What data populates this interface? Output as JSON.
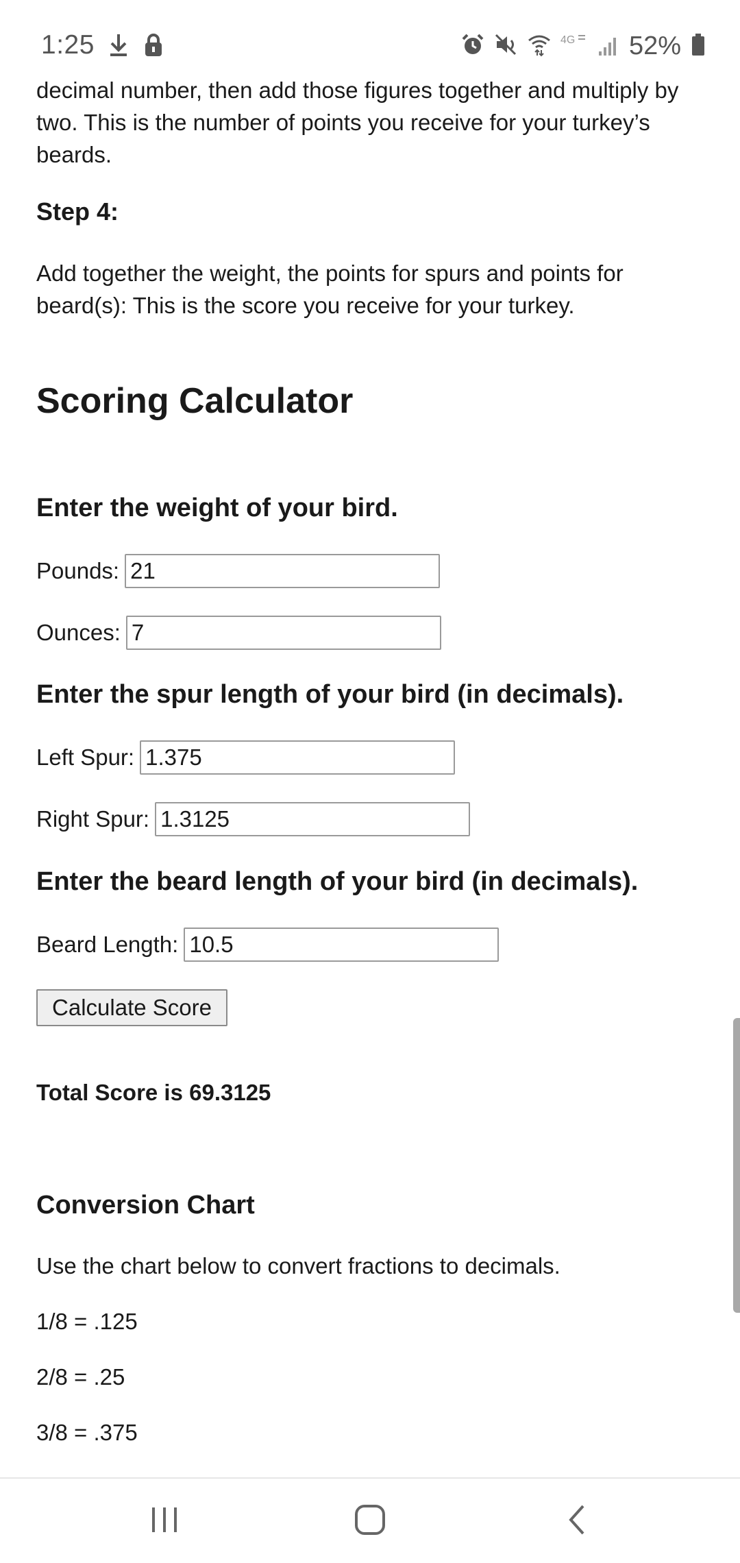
{
  "status_bar": {
    "time": "1:25",
    "battery_percent": "52%",
    "left_icons": [
      "download-icon",
      "lock-icon"
    ],
    "right_icons": [
      "alarm-icon",
      "mute-icon",
      "wifi-icon",
      "4g-icon",
      "signal-icon",
      "battery-icon"
    ],
    "network_label": "4G"
  },
  "intro": {
    "paragraph": "decimal number, then add those figures together and multiply by two. This is the number of points you receive for your turkey’s beards."
  },
  "step4": {
    "heading": "Step 4:",
    "text": "Add together the weight, the points for spurs and points for beard(s): This is the score you receive for your turkey."
  },
  "calculator": {
    "title": "Scoring Calculator",
    "weight_heading": "Enter the weight of your bird.",
    "pounds_label": "Pounds:",
    "pounds_value": "21",
    "ounces_label": "Ounces:",
    "ounces_value": "7",
    "spur_heading": "Enter the spur length of your bird (in decimals).",
    "left_spur_label": "Left Spur:",
    "left_spur_value": "1.375",
    "right_spur_label": "Right Spur:",
    "right_spur_value": "1.3125",
    "beard_heading": "Enter the beard length of your bird (in decimals).",
    "beard_label": "Beard Length:",
    "beard_value": "10.5",
    "button_label": "Calculate Score",
    "total_score": "Total Score is 69.3125"
  },
  "conversion": {
    "heading": "Conversion Chart",
    "intro": "Use the chart below to convert fractions to decimals.",
    "rows": [
      "1/8 = .125",
      "2/8 = .25",
      "3/8 = .375"
    ]
  }
}
